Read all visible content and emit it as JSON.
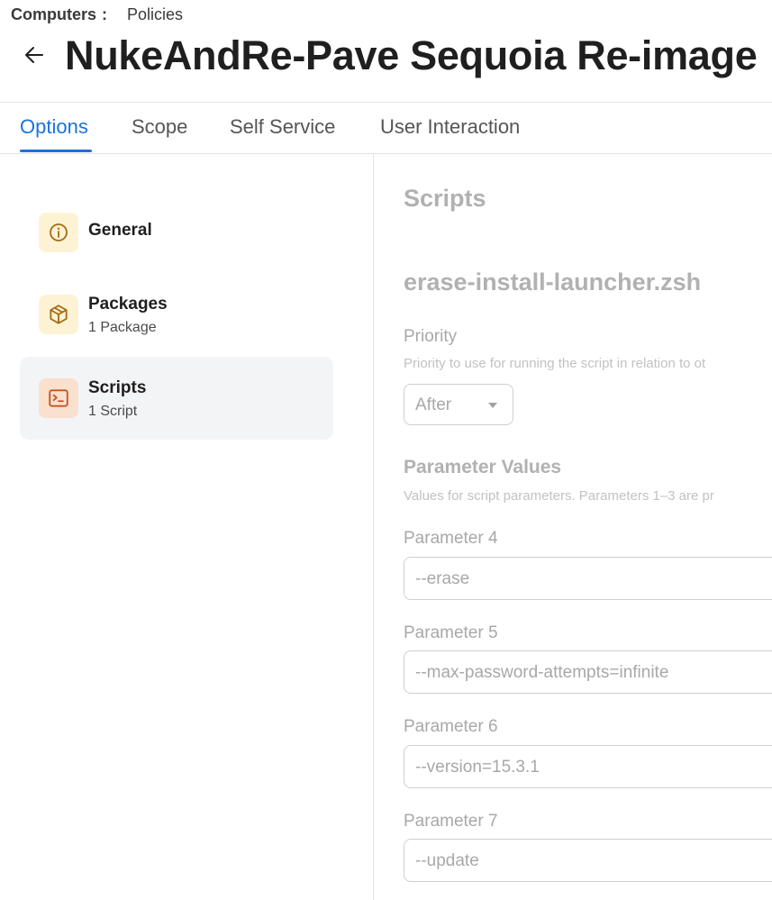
{
  "breadcrumb": {
    "root": "Computers",
    "separator": ":",
    "current": "Policies"
  },
  "page": {
    "title": "NukeAndRe-Pave Sequoia Re-image"
  },
  "tabs": [
    {
      "label": "Options",
      "active": true
    },
    {
      "label": "Scope",
      "active": false
    },
    {
      "label": "Self Service",
      "active": false
    },
    {
      "label": "User Interaction",
      "active": false
    }
  ],
  "sidebar": {
    "items": [
      {
        "label": "General",
        "sublabel": "",
        "icon": "info-icon",
        "selected": false
      },
      {
        "label": "Packages",
        "sublabel": "1 Package",
        "icon": "package-icon",
        "selected": false
      },
      {
        "label": "Scripts",
        "sublabel": "1 Script",
        "icon": "terminal-icon",
        "selected": true
      }
    ]
  },
  "main": {
    "section_title": "Scripts",
    "script_name": "erase-install-launcher.zsh",
    "priority": {
      "label": "Priority",
      "help": "Priority to use for running the script in relation to ot",
      "value": "After"
    },
    "parameters": {
      "heading": "Parameter Values",
      "help": "Values for script parameters. Parameters 1–3 are pr",
      "fields": [
        {
          "label": "Parameter 4",
          "value": "--erase"
        },
        {
          "label": "Parameter 5",
          "value": "--max-password-attempts=infinite"
        },
        {
          "label": "Parameter 6",
          "value": "--version=15.3.1"
        },
        {
          "label": "Parameter 7",
          "value": "--update"
        }
      ]
    }
  },
  "colors": {
    "accent": "#1a73d9",
    "icon_yellow_bg": "#fdf3d4",
    "icon_yellow_fg": "#a86a12",
    "icon_orange_bg": "#fae0cf",
    "icon_orange_fg": "#c6541f",
    "disabled_text": "#a8a8a8",
    "selected_bg": "#f3f4f6"
  }
}
